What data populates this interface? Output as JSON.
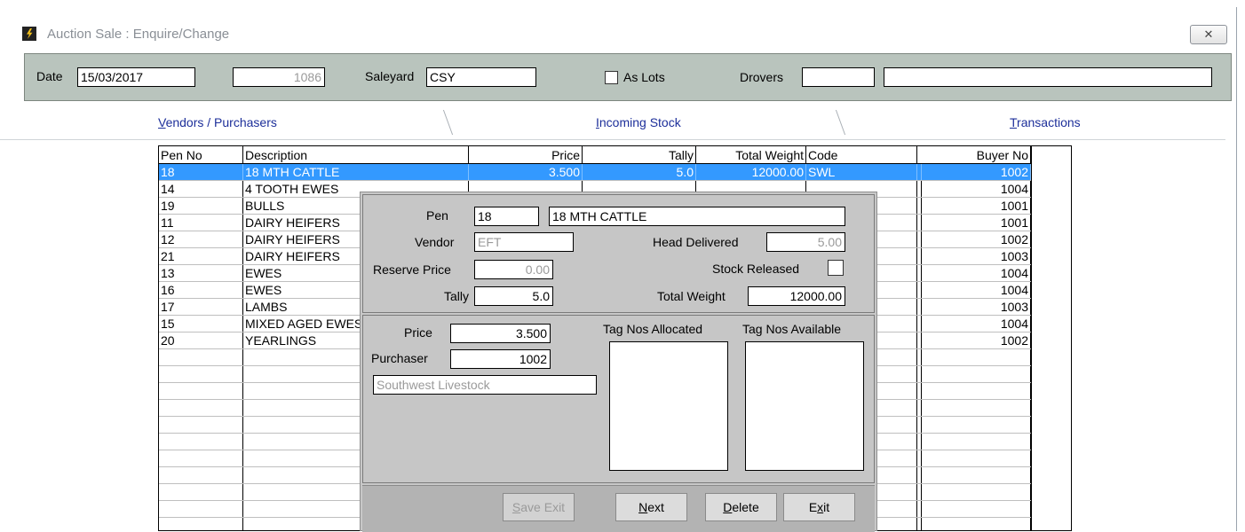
{
  "window": {
    "title": "Auction Sale : Enquire/Change",
    "close_label": "✕"
  },
  "header": {
    "date_label": "Date",
    "date_value": "15/03/2017",
    "sale_no": "1086",
    "saleyard_label": "Saleyard",
    "saleyard_value": "CSY",
    "as_lots_label": "As Lots",
    "as_lots_checked": false,
    "drovers_label": "Drovers",
    "drovers_code": "",
    "drovers_name": ""
  },
  "tabs": [
    {
      "label": "Vendors / Purchasers",
      "hotkey": "V",
      "rest": "endors / Purchasers"
    },
    {
      "label": "Incoming Stock",
      "hotkey": "I",
      "rest": "ncoming Stock"
    },
    {
      "label": "Transactions",
      "hotkey": "T",
      "rest": "ransactions"
    }
  ],
  "grid": {
    "columns": [
      "Pen No",
      "Description",
      "Price",
      "Tally",
      "Total Weight",
      "Code",
      "",
      "Buyer No"
    ],
    "rows": [
      {
        "pen": "18",
        "desc": "18 MTH CATTLE",
        "price": "3.500",
        "tally": "5.0",
        "weight": "12000.00",
        "code": "SWL",
        "buyer": "1002",
        "selected": true
      },
      {
        "pen": "14",
        "desc": "4 TOOTH EWES",
        "price": "",
        "tally": "",
        "weight": "",
        "code": "",
        "buyer": "1004"
      },
      {
        "pen": "19",
        "desc": "BULLS",
        "price": "",
        "tally": "",
        "weight": "",
        "code": "",
        "buyer": "1001"
      },
      {
        "pen": "11",
        "desc": "DAIRY HEIFERS",
        "price": "",
        "tally": "",
        "weight": "",
        "code": "",
        "buyer": "1001"
      },
      {
        "pen": "12",
        "desc": "DAIRY HEIFERS",
        "price": "",
        "tally": "",
        "weight": "",
        "code": "",
        "buyer": "1002"
      },
      {
        "pen": "21",
        "desc": "DAIRY HEIFERS",
        "price": "",
        "tally": "",
        "weight": "",
        "code": "",
        "buyer": "1003"
      },
      {
        "pen": "13",
        "desc": "EWES",
        "price": "",
        "tally": "",
        "weight": "",
        "code": "",
        "buyer": "1004"
      },
      {
        "pen": "16",
        "desc": "EWES",
        "price": "",
        "tally": "",
        "weight": "",
        "code": "",
        "buyer": "1004"
      },
      {
        "pen": "17",
        "desc": "LAMBS",
        "price": "",
        "tally": "",
        "weight": "",
        "code": "",
        "buyer": "1003"
      },
      {
        "pen": "15",
        "desc": "MIXED AGED EWES",
        "price": "",
        "tally": "",
        "weight": "",
        "code": "",
        "buyer": "1004"
      },
      {
        "pen": "20",
        "desc": "YEARLINGS",
        "price": "",
        "tally": "",
        "weight": "",
        "code": "",
        "buyer": "1002"
      }
    ]
  },
  "dialog": {
    "pen_label": "Pen",
    "pen_value": "18",
    "pen_desc": "18 MTH CATTLE",
    "vendor_label": "Vendor",
    "vendor_value": "EFT",
    "head_delivered_label": "Head Delivered",
    "head_delivered_value": "5.00",
    "reserve_label": "Reserve Price",
    "reserve_value": "0.00",
    "stock_released_label": "Stock Released",
    "stock_released_checked": false,
    "tally_label": "Tally",
    "tally_value": "5.0",
    "total_weight_label": "Total Weight",
    "total_weight_value": "12000.00",
    "price_label": "Price",
    "price_value": "3.500",
    "purchaser_label": "Purchaser",
    "purchaser_value": "1002",
    "purchaser_name": "Southwest Livestock",
    "tags_allocated_label": "Tag Nos Allocated",
    "tags_available_label": "Tag Nos Available",
    "buttons": {
      "save_exit": {
        "hotkey": "S",
        "rest": "ave Exit"
      },
      "next": {
        "hotkey": "N",
        "rest": "ext"
      },
      "delete": {
        "hotkey": "D",
        "rest": "elete"
      },
      "exit": {
        "pre": "E",
        "hotkey": "x",
        "rest": "it"
      }
    }
  }
}
